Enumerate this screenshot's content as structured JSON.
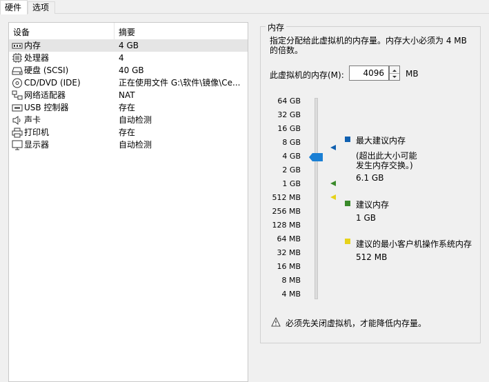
{
  "tabs": [
    "硬件",
    "选项"
  ],
  "device_list": {
    "headers": {
      "device": "设备",
      "summary": "摘要"
    },
    "rows": [
      {
        "icon": "memory-icon",
        "name": "内存",
        "summary": "4 GB",
        "selected": true
      },
      {
        "icon": "cpu-icon",
        "name": "处理器",
        "summary": "4"
      },
      {
        "icon": "hard-disk-icon",
        "name": "硬盘 (SCSI)",
        "summary": "40 GB"
      },
      {
        "icon": "cd-dvd-icon",
        "name": "CD/DVD (IDE)",
        "summary": "正在使用文件 G:\\软件\\镜像\\Ce..."
      },
      {
        "icon": "network-adapter-icon",
        "name": "网络适配器",
        "summary": "NAT"
      },
      {
        "icon": "usb-icon",
        "name": "USB 控制器",
        "summary": "存在"
      },
      {
        "icon": "sound-card-icon",
        "name": "声卡",
        "summary": "自动检测"
      },
      {
        "icon": "printer-icon",
        "name": "打印机",
        "summary": "存在"
      },
      {
        "icon": "display-icon",
        "name": "显示器",
        "summary": "自动检测"
      }
    ]
  },
  "memory": {
    "group_title": "内存",
    "description": "指定分配给此虚拟机的内存量。内存大小必须为 4 MB 的倍数。",
    "field_label": "此虚拟机的内存(M):",
    "value": "4096",
    "unit": "MB",
    "scale": [
      "64 GB",
      "32 GB",
      "16 GB",
      "8 GB",
      "4 GB",
      "2 GB",
      "1 GB",
      "512 MB",
      "256 MB",
      "128 MB",
      "64 MB",
      "32 MB",
      "16 MB",
      "8 MB",
      "4 MB"
    ],
    "current_level": "4 GB",
    "legend": {
      "max": {
        "title": "最大建议内存",
        "note1": "(超出此大小可能",
        "note2": "发生内存交换。)",
        "value": "6.1 GB",
        "color": "#1060b0"
      },
      "recommended": {
        "title": "建议内存",
        "value": "1 GB",
        "color": "#3a8a2a"
      },
      "min_guest": {
        "title": "建议的最小客户机操作系统内存",
        "value": "512 MB",
        "color": "#e6d21a"
      }
    },
    "warning": "必须先关闭虚拟机，才能降低内存量。"
  },
  "colors": {
    "thumb": "#1a7fd4",
    "selected_row": "#e5e5e5"
  }
}
